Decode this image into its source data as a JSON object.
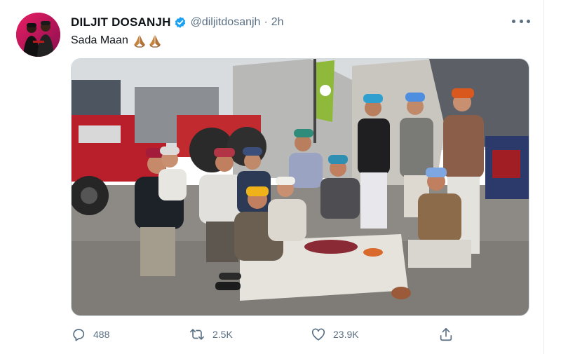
{
  "tweet": {
    "author_name": "DILJIT DOSANJH",
    "handle": "@diljitdosanjh",
    "separator": "·",
    "time": "2h",
    "text": "Sada Maan",
    "emoji": [
      "folded-hands",
      "folded-hands"
    ]
  },
  "actions": {
    "replies": "488",
    "retweets": "2.5K",
    "likes": "23.9K"
  },
  "colors": {
    "verified": "#1da1f2",
    "secondary_text": "#5b7083",
    "border": "#cfd9de"
  }
}
